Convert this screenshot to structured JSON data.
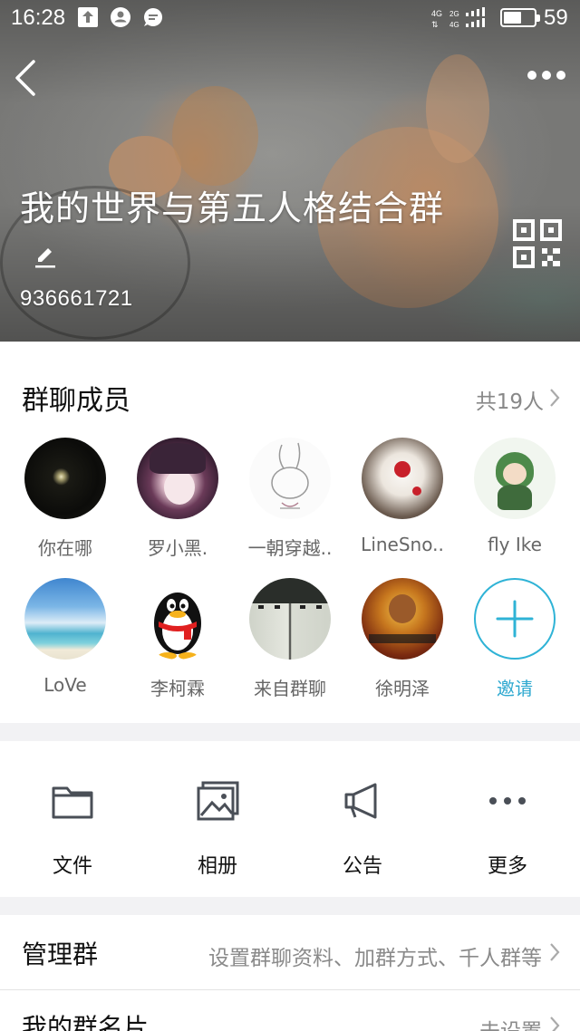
{
  "status_bar": {
    "time": "16:28",
    "network_top": "4G",
    "network_bottom": "4G",
    "battery": "59",
    "battery_level": 0.59
  },
  "header": {
    "group_name": "我的世界与第五人格结合群",
    "group_id": "936661721"
  },
  "members": {
    "title": "群聊成员",
    "count": "共19人",
    "items": [
      {
        "name": "你在哪",
        "avatar": "moon-night"
      },
      {
        "name": "罗小黑.",
        "avatar": "anime-girl-purple"
      },
      {
        "name": "一朝穿越..",
        "avatar": "bunny-sketch"
      },
      {
        "name": "LineSno..",
        "avatar": "white-hair-red-flower"
      },
      {
        "name": "fly Ike",
        "avatar": "green-hood-chibi"
      },
      {
        "name": "LoVe",
        "avatar": "sky-sea"
      },
      {
        "name": "李柯霖",
        "avatar": "qq-penguin"
      },
      {
        "name": "来自群聊",
        "avatar": "two-girls-photo"
      },
      {
        "name": "徐明泽",
        "avatar": "monkey-king-game"
      }
    ],
    "invite_label": "邀请"
  },
  "actions": [
    {
      "label": "文件",
      "icon": "folder-icon"
    },
    {
      "label": "相册",
      "icon": "album-icon"
    },
    {
      "label": "公告",
      "icon": "megaphone-icon"
    },
    {
      "label": "更多",
      "icon": "more-dots-icon"
    }
  ],
  "rows": {
    "manage": {
      "title": "管理群",
      "value": "设置群聊资料、加群方式、千人群等"
    },
    "my_card": {
      "title": "我的群名片",
      "value": "未设置"
    }
  },
  "colors": {
    "accent": "#2fb3d6",
    "background": "#f2f2f4",
    "secondary_text": "#888888"
  }
}
